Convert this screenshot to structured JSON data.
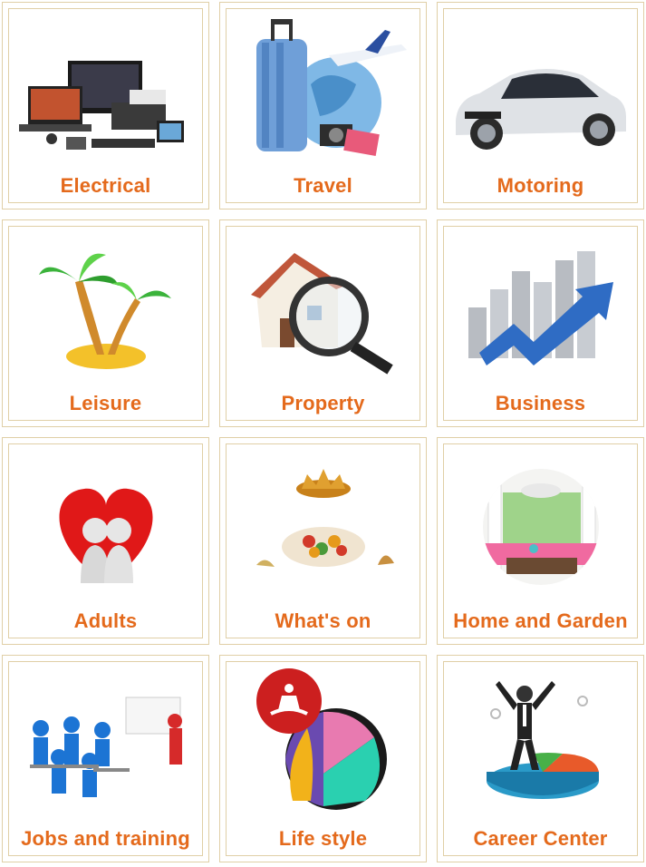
{
  "categories": [
    {
      "label": "Electrical",
      "icon": "electronics-icon"
    },
    {
      "label": "Travel",
      "icon": "luggage-airplane-globe-icon"
    },
    {
      "label": "Motoring",
      "icon": "car-icon"
    },
    {
      "label": "Leisure",
      "icon": "palm-tree-island-icon"
    },
    {
      "label": "Property",
      "icon": "house-magnifier-icon"
    },
    {
      "label": "Business",
      "icon": "growth-chart-arrow-icon"
    },
    {
      "label": "Adults",
      "icon": "heart-couple-icon"
    },
    {
      "label": "What's on",
      "icon": "food-crown-icon"
    },
    {
      "label": "Home and Garden",
      "icon": "patio-room-icon"
    },
    {
      "label": "Jobs and training",
      "icon": "classroom-presentation-icon"
    },
    {
      "label": "Life style",
      "icon": "yoga-faces-icon"
    },
    {
      "label": "Career Center",
      "icon": "success-pie-chart-icon"
    }
  ],
  "colors": {
    "label": "#e46a1c",
    "border": "#e0cfa6"
  }
}
